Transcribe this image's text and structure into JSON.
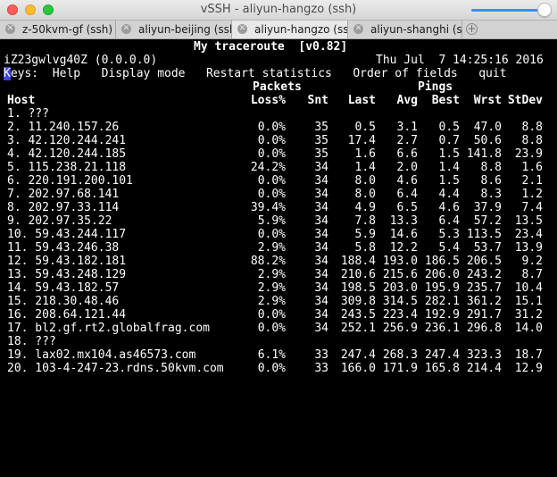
{
  "window": {
    "title": "vSSH - aliyun-hangzo (ssh)"
  },
  "tabs": [
    {
      "label": "z-50kvm-gf (ssh)"
    },
    {
      "label": "aliyun-beijing (ssh)"
    },
    {
      "label": "aliyun-hangzo (ss..."
    },
    {
      "label": "aliyun-shanghi (s..."
    }
  ],
  "terminal": {
    "app_title": "My traceroute  [v0.82]",
    "host_line": "iZ23gwlvg40Z (0.0.0.0)",
    "datetime": "Thu Jul  7 14:25:16 2016",
    "keys_first": "K",
    "keys_rest": "eys:  Help   Display mode   Restart statistics   Order of fields   quit",
    "packets_header": "Packets",
    "pings_header": "Pings",
    "col_host": "Host",
    "col_loss": "Loss%",
    "col_snt": "Snt",
    "col_last": "Last",
    "col_avg": "Avg",
    "col_best": "Best",
    "col_wrst": "Wrst",
    "col_stdev": "StDev",
    "hops": [
      [
        "1. ???",
        "",
        "",
        "",
        "",
        "",
        "",
        ""
      ],
      [
        "2. 11.240.157.26",
        "0.0%",
        "35",
        "0.5",
        "3.1",
        "0.5",
        "47.0",
        "8.8"
      ],
      [
        "3. 42.120.244.241",
        "0.0%",
        "35",
        "17.4",
        "2.7",
        "0.7",
        "50.6",
        "8.8"
      ],
      [
        "4. 42.120.244.185",
        "0.0%",
        "35",
        "1.6",
        "6.6",
        "1.5",
        "141.8",
        "23.9"
      ],
      [
        "5. 115.238.21.118",
        "24.2%",
        "34",
        "1.4",
        "2.0",
        "1.4",
        "8.8",
        "1.6"
      ],
      [
        "6. 220.191.200.101",
        "0.0%",
        "34",
        "8.0",
        "4.6",
        "1.5",
        "8.6",
        "2.1"
      ],
      [
        "7. 202.97.68.141",
        "0.0%",
        "34",
        "8.0",
        "6.4",
        "4.4",
        "8.3",
        "1.2"
      ],
      [
        "8. 202.97.33.114",
        "39.4%",
        "34",
        "4.9",
        "6.5",
        "4.6",
        "37.9",
        "7.4"
      ],
      [
        "9. 202.97.35.22",
        "5.9%",
        "34",
        "7.8",
        "13.3",
        "6.4",
        "57.2",
        "13.5"
      ],
      [
        "10. 59.43.244.117",
        "0.0%",
        "34",
        "5.9",
        "14.6",
        "5.3",
        "113.5",
        "23.4"
      ],
      [
        "11. 59.43.246.38",
        "2.9%",
        "34",
        "5.8",
        "12.2",
        "5.4",
        "53.7",
        "13.9"
      ],
      [
        "12. 59.43.182.181",
        "88.2%",
        "34",
        "188.4",
        "193.0",
        "186.5",
        "206.5",
        "9.2"
      ],
      [
        "13. 59.43.248.129",
        "2.9%",
        "34",
        "210.6",
        "215.6",
        "206.0",
        "243.2",
        "8.7"
      ],
      [
        "14. 59.43.182.57",
        "2.9%",
        "34",
        "198.5",
        "203.0",
        "195.9",
        "235.7",
        "10.4"
      ],
      [
        "15. 218.30.48.46",
        "2.9%",
        "34",
        "309.8",
        "314.5",
        "282.1",
        "361.2",
        "15.1"
      ],
      [
        "16. 208.64.121.44",
        "0.0%",
        "34",
        "243.5",
        "223.4",
        "192.9",
        "291.7",
        "31.2"
      ],
      [
        "17. bl2.gf.rt2.globalfrag.com",
        "0.0%",
        "34",
        "252.1",
        "256.9",
        "236.1",
        "296.8",
        "14.0"
      ],
      [
        "18. ???",
        "",
        "",
        "",
        "",
        "",
        "",
        ""
      ],
      [
        "19. lax02.mx104.as46573.com",
        "6.1%",
        "33",
        "247.4",
        "268.3",
        "247.4",
        "323.3",
        "18.7"
      ],
      [
        "20. 103-4-247-23.rdns.50kvm.com",
        "0.0%",
        "33",
        "166.0",
        "171.9",
        "165.8",
        "214.4",
        "12.9"
      ]
    ]
  }
}
